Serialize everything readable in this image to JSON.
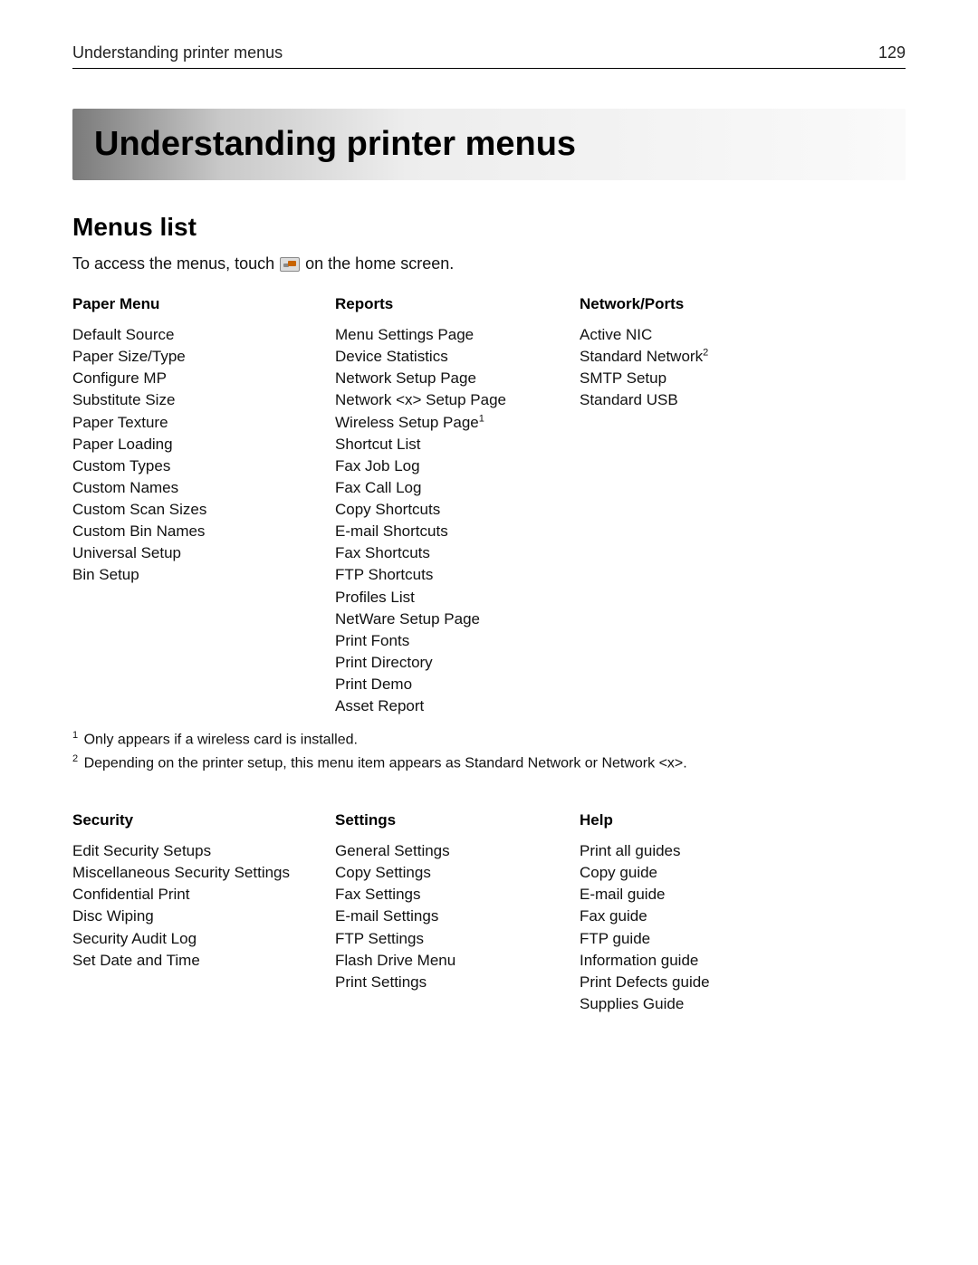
{
  "header": {
    "breadcrumb": "Understanding printer menus",
    "page_number": "129"
  },
  "title": "Understanding printer menus",
  "section_title": "Menus list",
  "intro": {
    "pre": "To access the menus, touch",
    "post": "on the home screen."
  },
  "groups_top": {
    "paper_menu": {
      "heading": "Paper Menu",
      "items": [
        "Default Source",
        "Paper Size/Type",
        "Configure MP",
        "Substitute Size",
        "Paper Texture",
        "Paper Loading",
        "Custom Types",
        "Custom Names",
        "Custom Scan Sizes",
        "Custom Bin Names",
        "Universal Setup",
        "Bin Setup"
      ]
    },
    "reports": {
      "heading": "Reports",
      "items": [
        {
          "text": "Menu Settings Page"
        },
        {
          "text": "Device Statistics"
        },
        {
          "text": "Network Setup Page"
        },
        {
          "text": "Network <x> Setup Page"
        },
        {
          "text": "Wireless Setup Page",
          "sup": "1"
        },
        {
          "text": "Shortcut List"
        },
        {
          "text": "Fax Job Log"
        },
        {
          "text": "Fax Call Log"
        },
        {
          "text": "Copy Shortcuts"
        },
        {
          "text": "E-mail Shortcuts"
        },
        {
          "text": "Fax Shortcuts"
        },
        {
          "text": "FTP Shortcuts"
        },
        {
          "text": "Profiles List"
        },
        {
          "text": "NetWare Setup Page"
        },
        {
          "text": "Print Fonts"
        },
        {
          "text": "Print Directory"
        },
        {
          "text": "Print Demo"
        },
        {
          "text": "Asset Report"
        }
      ]
    },
    "network_ports": {
      "heading": "Network/Ports",
      "items": [
        {
          "text": "Active NIC"
        },
        {
          "text": "Standard Network",
          "sup": "2"
        },
        {
          "text": "SMTP Setup"
        },
        {
          "text": "Standard USB"
        }
      ]
    }
  },
  "footnotes": {
    "1": "Only appears if a wireless card is installed.",
    "2": "Depending on the printer setup, this menu item appears as Standard Network or Network <x>."
  },
  "groups_bottom": {
    "security": {
      "heading": "Security",
      "items": [
        "Edit Security Setups",
        "Miscellaneous Security Settings",
        "Confidential Print",
        "Disc Wiping",
        "Security Audit Log",
        "Set Date and Time"
      ]
    },
    "settings": {
      "heading": "Settings",
      "items": [
        "General Settings",
        "Copy Settings",
        "Fax Settings",
        "E-mail Settings",
        "FTP Settings",
        "Flash Drive Menu",
        "Print Settings"
      ]
    },
    "help": {
      "heading": "Help",
      "items": [
        "Print all guides",
        "Copy guide",
        "E-mail guide",
        "Fax guide",
        "FTP guide",
        "Information guide",
        "Print Defects guide",
        "Supplies Guide"
      ]
    }
  }
}
